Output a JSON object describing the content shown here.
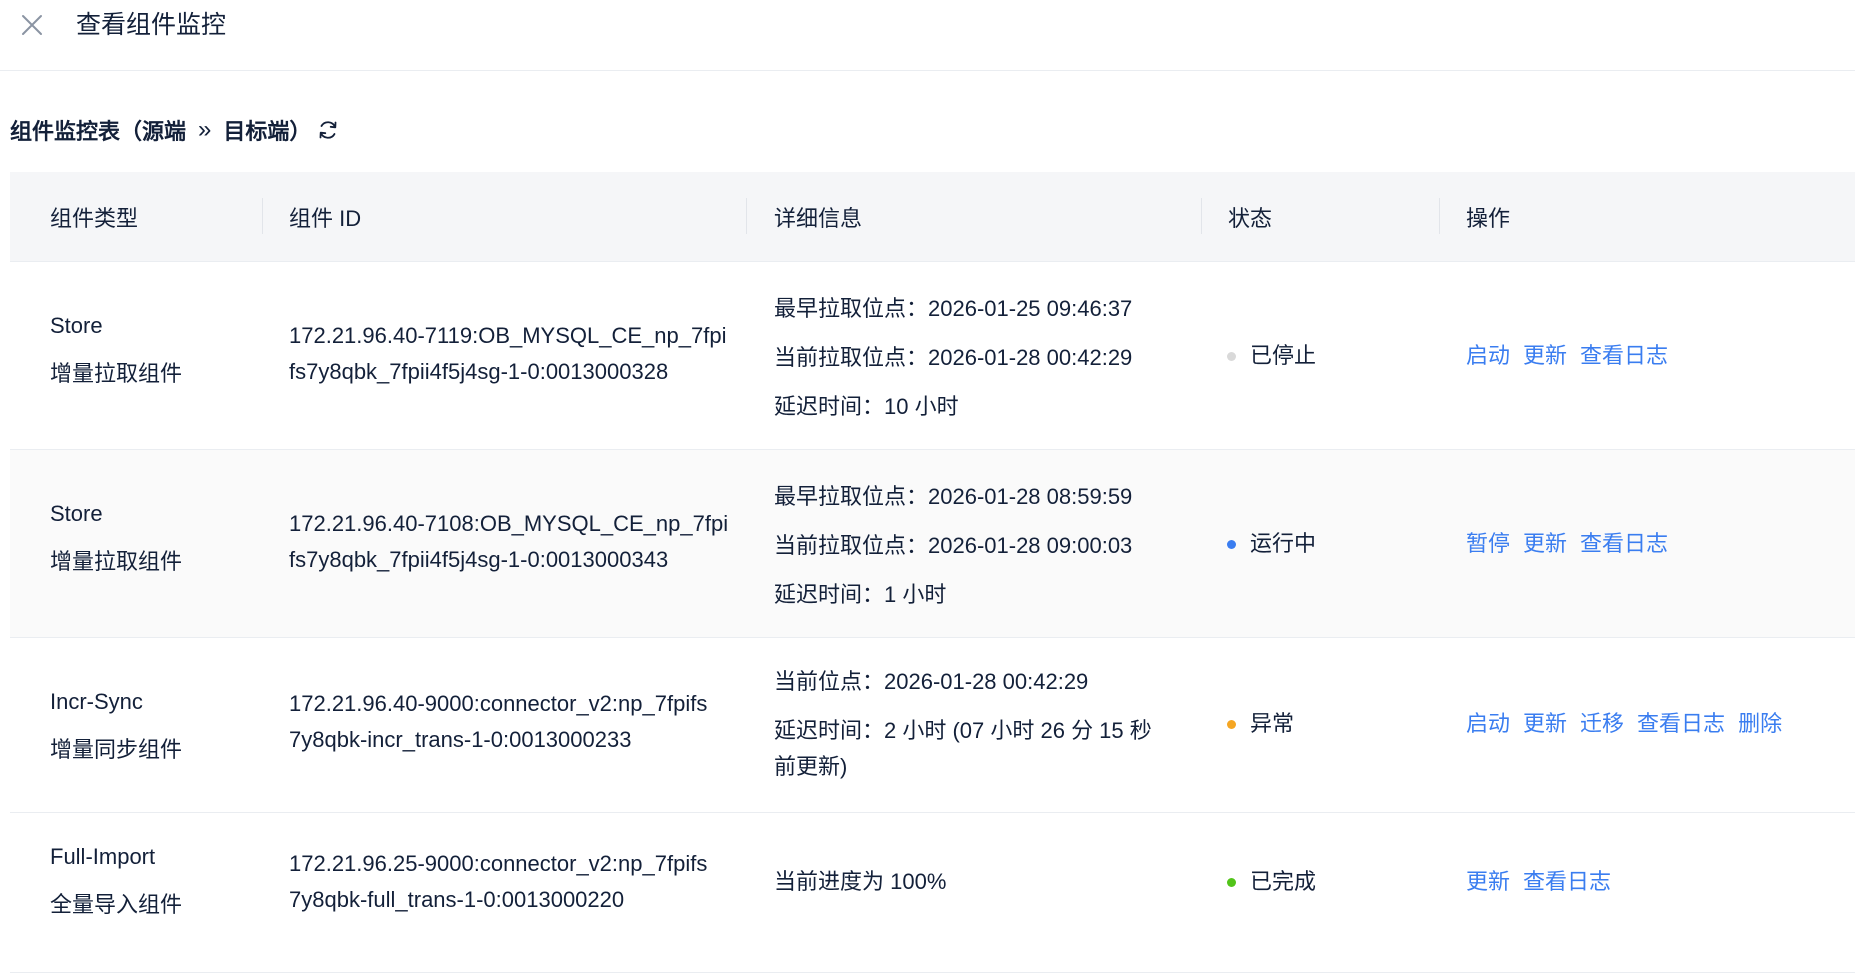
{
  "header": {
    "title": "查看组件监控"
  },
  "section": {
    "title_prefix": "组件监控表（源端",
    "arrows": "»",
    "title_suffix": "目标端）"
  },
  "table": {
    "columns": [
      "组件类型",
      "组件 ID",
      "详细信息",
      "状态",
      "操作"
    ],
    "rows": [
      {
        "type_en": "Store",
        "type_cn": "增量拉取组件",
        "id_line1": "172.21.96.40-7119:OB_MYSQL_CE_np_7fpi",
        "id_line2": "fs7y8qbk_7fpii4f5j4sg-1-0:0013000328",
        "details": [
          "最早拉取位点：2026-01-25 09:46:37",
          "当前拉取位点：2026-01-28 00:42:29",
          "延迟时间：10 小时"
        ],
        "status": "已停止",
        "status_color": "#d9d9d9",
        "ops": [
          "启动",
          "更新",
          "查看日志"
        ]
      },
      {
        "type_en": "Store",
        "type_cn": "增量拉取组件",
        "id_line1": "172.21.96.40-7108:OB_MYSQL_CE_np_7fpi",
        "id_line2": "fs7y8qbk_7fpii4f5j4sg-1-0:0013000343",
        "details": [
          "最早拉取位点：2026-01-28 08:59:59",
          "当前拉取位点：2026-01-28 09:00:03",
          "延迟时间：1 小时"
        ],
        "status": "运行中",
        "status_color": "#3a7df0",
        "ops": [
          "暂停",
          "更新",
          "查看日志"
        ]
      },
      {
        "type_en": "Incr-Sync",
        "type_cn": "增量同步组件",
        "id_line1": "172.21.96.40-9000:connector_v2:np_7fpifs",
        "id_line2": "7y8qbk-incr_trans-1-0:0013000233",
        "details": [
          "当前位点：2026-01-28 00:42:29",
          "延迟时间：2 小时 (07 小时 26 分 15 秒",
          "前更新)"
        ],
        "status": "异常",
        "status_color": "#f5a623",
        "ops": [
          "启动",
          "更新",
          "迁移",
          "查看日志",
          "删除"
        ]
      },
      {
        "type_en": "Full-Import",
        "type_cn": "全量导入组件",
        "id_line1": "172.21.96.25-9000:connector_v2:np_7fpifs",
        "id_line2": "7y8qbk-full_trans-1-0:0013000220",
        "details": [
          "当前进度为 100%"
        ],
        "status": "已完成",
        "status_color": "#52c41a",
        "ops": [
          "更新",
          "查看日志"
        ]
      }
    ]
  }
}
